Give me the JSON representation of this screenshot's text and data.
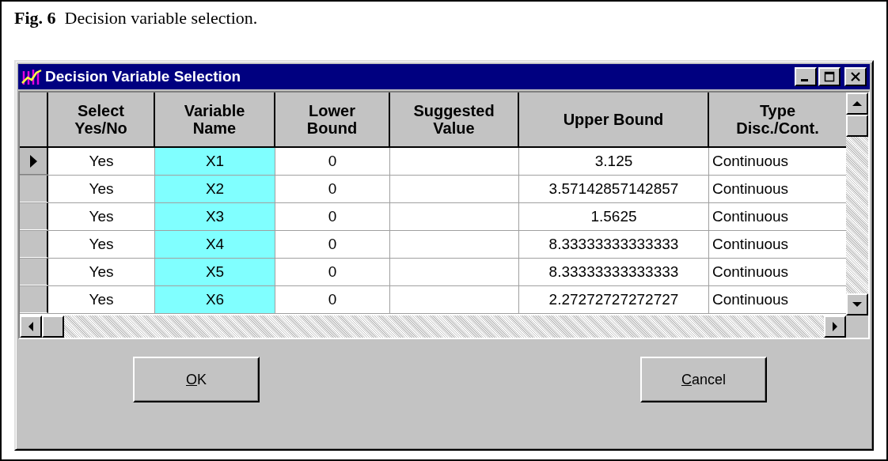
{
  "caption": {
    "label": "Fig. 6",
    "text": "Decision variable selection."
  },
  "window": {
    "title": "Decision Variable Selection",
    "active": true
  },
  "table": {
    "columns": [
      {
        "line1": "Select",
        "line2": "Yes/No",
        "highlighted": false
      },
      {
        "line1": "Variable",
        "line2": "Name",
        "highlighted": true
      },
      {
        "line1": "Lower",
        "line2": "Bound",
        "highlighted": false
      },
      {
        "line1": "Suggested",
        "line2": "Value",
        "highlighted": false
      },
      {
        "line1": "Upper Bound",
        "highlighted": false
      },
      {
        "line1": "Type",
        "line2": "Disc./Cont.",
        "highlighted": false
      }
    ],
    "rows": [
      {
        "current": true,
        "cells": [
          "Yes",
          "X1",
          "0",
          "",
          "3.125",
          "Continuous"
        ]
      },
      {
        "current": false,
        "cells": [
          "Yes",
          "X2",
          "0",
          "",
          "3.57142857142857",
          "Continuous"
        ]
      },
      {
        "current": false,
        "cells": [
          "Yes",
          "X3",
          "0",
          "",
          "1.5625",
          "Continuous"
        ]
      },
      {
        "current": false,
        "cells": [
          "Yes",
          "X4",
          "0",
          "",
          "8.33333333333333",
          "Continuous"
        ]
      },
      {
        "current": false,
        "cells": [
          "Yes",
          "X5",
          "0",
          "",
          "8.33333333333333",
          "Continuous"
        ]
      },
      {
        "current": false,
        "cells": [
          "Yes",
          "X6",
          "0",
          "",
          "2.27272727272727",
          "Continuous"
        ]
      }
    ]
  },
  "buttons": [
    {
      "label": "OK",
      "mnemonic": true
    },
    {
      "label": "Cancel",
      "mnemonic": true
    }
  ]
}
